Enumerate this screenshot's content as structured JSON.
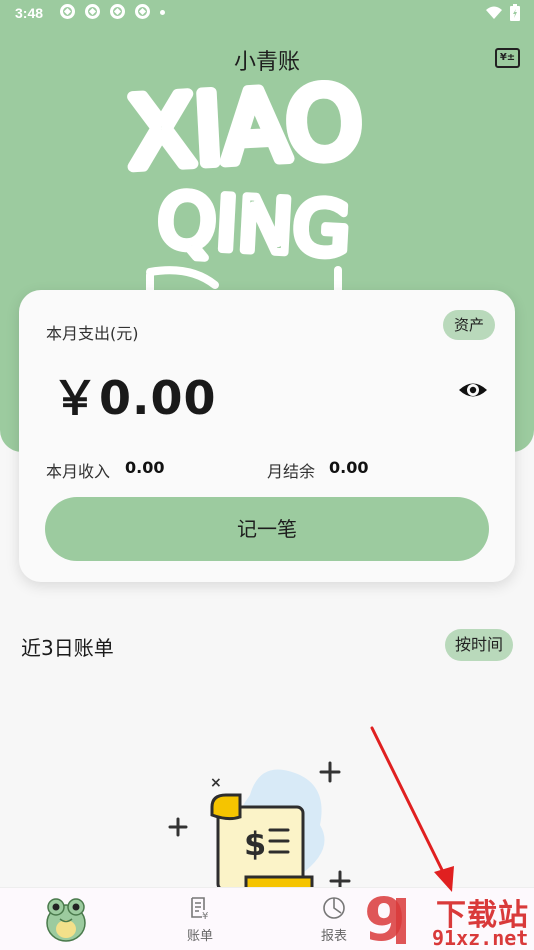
{
  "status_bar": {
    "time": "3:48"
  },
  "header": {
    "title": "小青账",
    "currency_icon_text": "¥±",
    "big_letters": [
      "XIAO",
      "QING"
    ]
  },
  "summary_card": {
    "expense_label": "本月支出(元)",
    "assets_badge": "资产",
    "amount": "￥0.00",
    "income_label": "本月收入",
    "income_value": "0.00",
    "balance_label": "月结余",
    "balance_value": "0.00",
    "record_button": "记一笔"
  },
  "recent": {
    "title": "近3日账单",
    "sort_button": "按时间"
  },
  "tab_bar": {
    "tabs": [
      {
        "label": "账单",
        "icon": "bill-icon"
      },
      {
        "label": "报表",
        "icon": "report-icon"
      }
    ]
  },
  "watermark": {
    "brand": "下载站",
    "domain": "91xz.net",
    "logo": "9"
  },
  "colors": {
    "primary_green": "#9ccb9f",
    "badge_green": "#b9d9bb",
    "arrow_red": "#e02020"
  }
}
